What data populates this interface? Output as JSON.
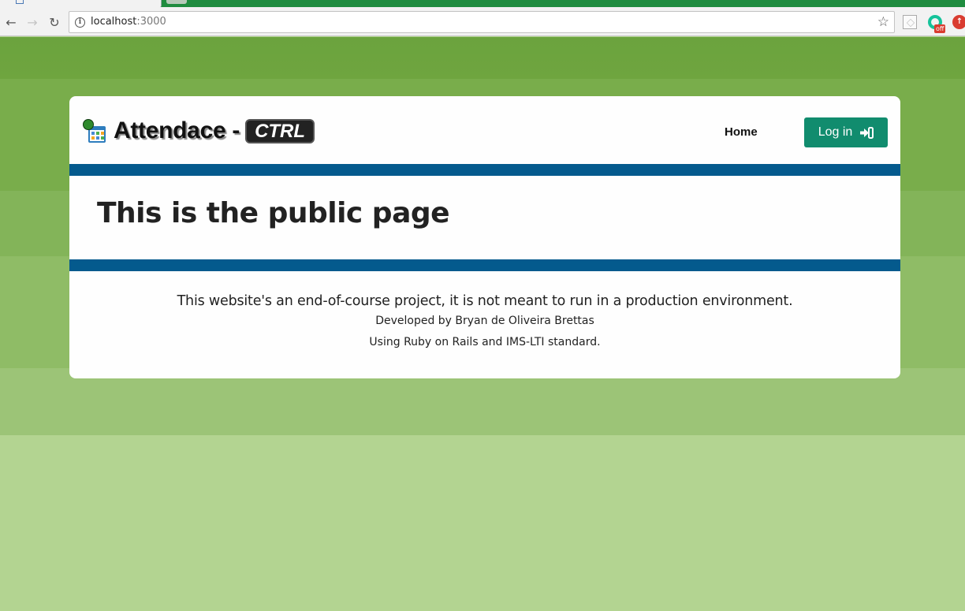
{
  "browser": {
    "url_host": "localhost",
    "url_port": ":3000",
    "extension_badge": "off"
  },
  "colors": {
    "accent_band": "#045a8d",
    "login_button": "#118c6e",
    "background": "#79ad4b"
  },
  "brand": {
    "name": "Attendace -",
    "badge": "CTRL"
  },
  "nav": {
    "home": "Home",
    "login": "Log in"
  },
  "main": {
    "title": "This is the public page"
  },
  "footer": {
    "disclaimer": "This website's an end-of-course project, it is not meant to run in a production environment.",
    "author": "Developed by Bryan de Oliveira Brettas",
    "stack": "Using Ruby on Rails and IMS-LTI standard."
  }
}
